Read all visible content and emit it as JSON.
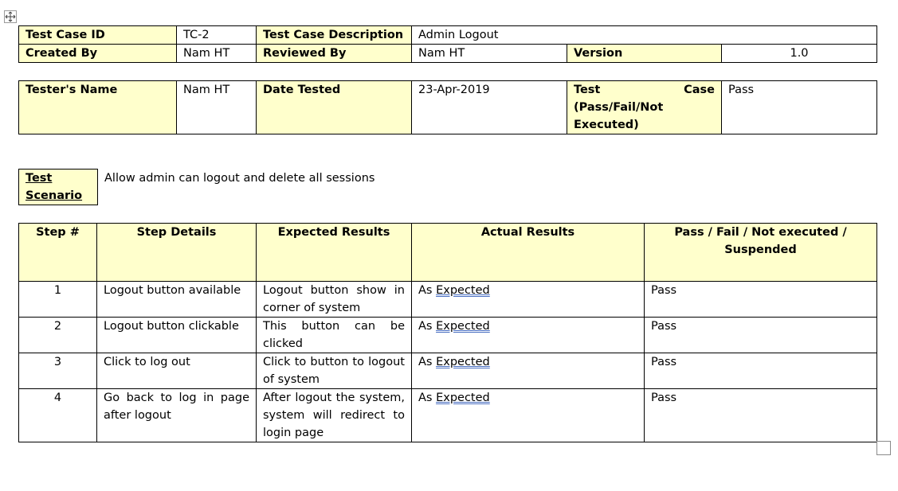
{
  "header": {
    "test_case_id_label": "Test Case ID",
    "test_case_id": "TC-2",
    "description_label": "Test Case Description",
    "description": "Admin Logout",
    "created_by_label": "Created By",
    "created_by": "Nam HT",
    "reviewed_by_label": "Reviewed By",
    "reviewed_by": "Nam HT",
    "version_label": "Version",
    "version": "1.0"
  },
  "tester": {
    "name_label": "Tester's Name",
    "name": "Nam HT",
    "date_label": "Date Tested",
    "date": "23-Apr-2019",
    "result_label_line1a": "Test",
    "result_label_line1b": "Case",
    "result_label_line2": "(Pass/Fail/Not",
    "result_label_line3": "Executed)",
    "result": "Pass"
  },
  "scenario": {
    "label_line1": "Test",
    "label_line2": "Scenario",
    "text": "Allow admin can logout and delete all sessions"
  },
  "steps": {
    "headers": {
      "step": "Step #",
      "details": "Step Details",
      "expected": "Expected Results",
      "actual": "Actual Results",
      "status_line1": "Pass / Fail / Not executed /",
      "status_line2": "Suspended"
    },
    "rows": [
      {
        "num": "1",
        "details": "Logout button available",
        "expected": "Logout button show in corner of system",
        "actual_prefix": "As",
        "actual_word": "Expected",
        "status": "Pass"
      },
      {
        "num": "2",
        "details": "Logout button clickable",
        "expected": "This button can be clicked",
        "actual_prefix": "As",
        "actual_word": "Expected",
        "status": "Pass"
      },
      {
        "num": "3",
        "details": "Click to log out",
        "expected": "Click to button to logout of system",
        "actual_prefix": "As",
        "actual_word": "Expected",
        "status": "Pass"
      },
      {
        "num": "4",
        "details": "Go back to log in page after logout",
        "expected": "After logout the system, system will redirect to login page",
        "actual_prefix": "As",
        "actual_word": "Expected",
        "status": "Pass"
      }
    ]
  },
  "icons": {
    "move_handle": "move-arrows-icon",
    "resize_handle": "resize-square-icon"
  }
}
